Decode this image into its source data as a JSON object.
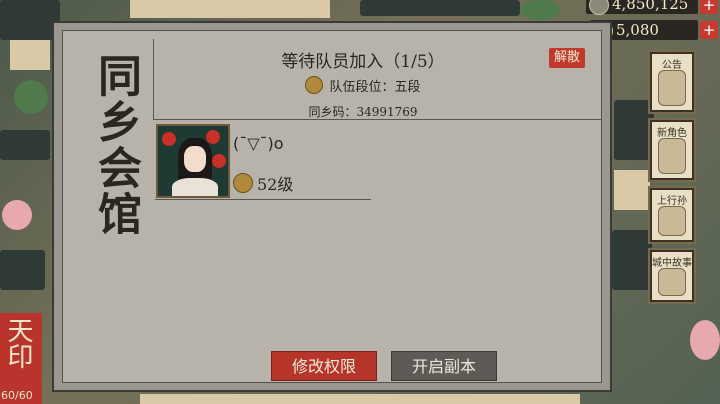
{
  "top_bar": {
    "currency_1": {
      "value": "4,850,125",
      "icon": "silver-coin-icon"
    },
    "currency_2": {
      "value": "5,080",
      "icon": "jade-icon"
    },
    "plus_label": "+"
  },
  "left_badge": {
    "text": "天印",
    "count": "60/60"
  },
  "side_menu": [
    {
      "label": "公告"
    },
    {
      "label": "新角色"
    },
    {
      "label": "上行孙"
    },
    {
      "label": "城中故事"
    }
  ],
  "panel": {
    "title": "同乡会馆",
    "status": "等待队员加入（1/5）",
    "rank_label": "队伍段位：五段",
    "code_label": "同乡码：34991769",
    "disband_button": "解散",
    "member": {
      "name": "(¯▽¯)o",
      "level": "52级"
    },
    "modify_button": "修改权限",
    "start_button": "开启副本"
  },
  "colors": {
    "accent_red": "#b5352b",
    "panel_bg": "#b7b3ab",
    "dark_button": "#5e5b56"
  }
}
